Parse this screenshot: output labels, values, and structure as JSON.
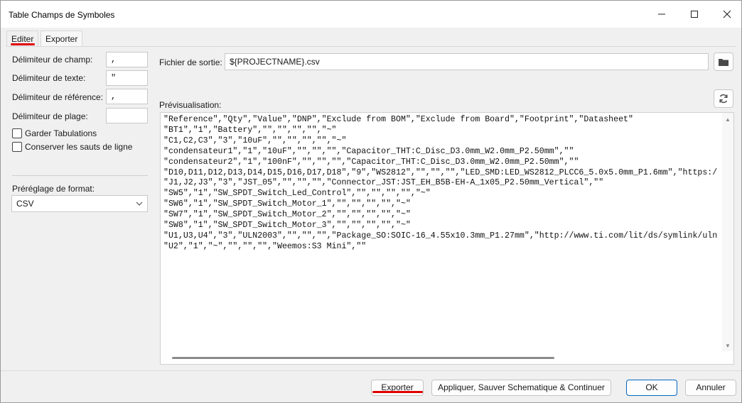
{
  "window": {
    "title": "Table Champs de Symboles",
    "controls": {
      "minimize": "—",
      "maximize": "☐",
      "close": "✕"
    }
  },
  "tabs": [
    {
      "label": "Editer",
      "active": false
    },
    {
      "label": "Exporter",
      "active": true
    }
  ],
  "left_panel": {
    "field_delimiter_label": "Délimiteur de champ:",
    "field_delimiter_value": ",",
    "text_delimiter_label": "Délimiteur de texte:",
    "text_delimiter_value": "\"",
    "ref_delimiter_label": "Délimiteur de référence:",
    "ref_delimiter_value": ",",
    "range_delimiter_label": "Délimiteur de plage:",
    "range_delimiter_value": "",
    "keep_tabs_label": "Garder Tabulations",
    "keep_tabs_checked": false,
    "keep_linebreaks_label": "Conserver les sauts de ligne",
    "keep_linebreaks_checked": false,
    "format_preset_label": "Préréglage de format:",
    "format_preset_value": "CSV"
  },
  "output": {
    "label": "Fichier de sortie:",
    "value": "${PROJECTNAME}.csv",
    "browse_icon": "folder-icon"
  },
  "preview": {
    "label": "Prévisualisation:",
    "refresh_icon": "refresh-icon",
    "lines": [
      "\"Reference\",\"Qty\",\"Value\",\"DNP\",\"Exclude from BOM\",\"Exclude from Board\",\"Footprint\",\"Datasheet\"",
      "\"BT1\",\"1\",\"Battery\",\"\",\"\",\"\",\"\",\"~\"",
      "\"C1,C2,C3\",\"3\",\"10uF\",\"\",\"\",\"\",\"\",\"~\"",
      "\"condensateur1\",\"1\",\"10uF\",\"\",\"\",\"\",\"Capacitor_THT:C_Disc_D3.0mm_W2.0mm_P2.50mm\",\"\"",
      "\"condensateur2\",\"1\",\"100nF\",\"\",\"\",\"\",\"Capacitor_THT:C_Disc_D3.0mm_W2.0mm_P2.50mm\",\"\"",
      "\"D10,D11,D12,D13,D14,D15,D16,D17,D18\",\"9\",\"WS2812\",\"\",\"\",\"\",\"LED_SMD:LED_WS2812_PLCC6_5.0x5.0mm_P1.6mm\",\"https:/",
      "\"J1,J2,J3\",\"3\",\"JST_05\",\"\",\"\",\"\",\"Connector_JST:JST_EH_B5B-EH-A_1x05_P2.50mm_Vertical\",\"\"",
      "\"SW5\",\"1\",\"SW_SPDT_Switch_Led_Control\",\"\",\"\",\"\",\"\",\"~\"",
      "\"SW6\",\"1\",\"SW_SPDT_Switch_Motor_1\",\"\",\"\",\"\",\"\",\"~\"",
      "\"SW7\",\"1\",\"SW_SPDT_Switch_Motor_2\",\"\",\"\",\"\",\"\",\"~\"",
      "\"SW8\",\"1\",\"SW_SPDT_Switch_Motor_3\",\"\",\"\",\"\",\"\",\"~\"",
      "\"U1,U3,U4\",\"3\",\"ULN2003\",\"\",\"\",\"\",\"Package_SO:SOIC-16_4.55x10.3mm_P1.27mm\",\"http://www.ti.com/lit/ds/symlink/uln",
      "\"U2\",\"1\",\"~\",\"\",\"\",\"\",\"Weemos:S3 Mini\",\"\""
    ]
  },
  "footer": {
    "export_label": "Exporter",
    "apply_label": "Appliquer, Sauver Schematique & Continuer",
    "ok_label": "OK",
    "cancel_label": "Annuler"
  },
  "colors": {
    "annotation_red": "#e00000",
    "primary_border": "#0067c0"
  }
}
